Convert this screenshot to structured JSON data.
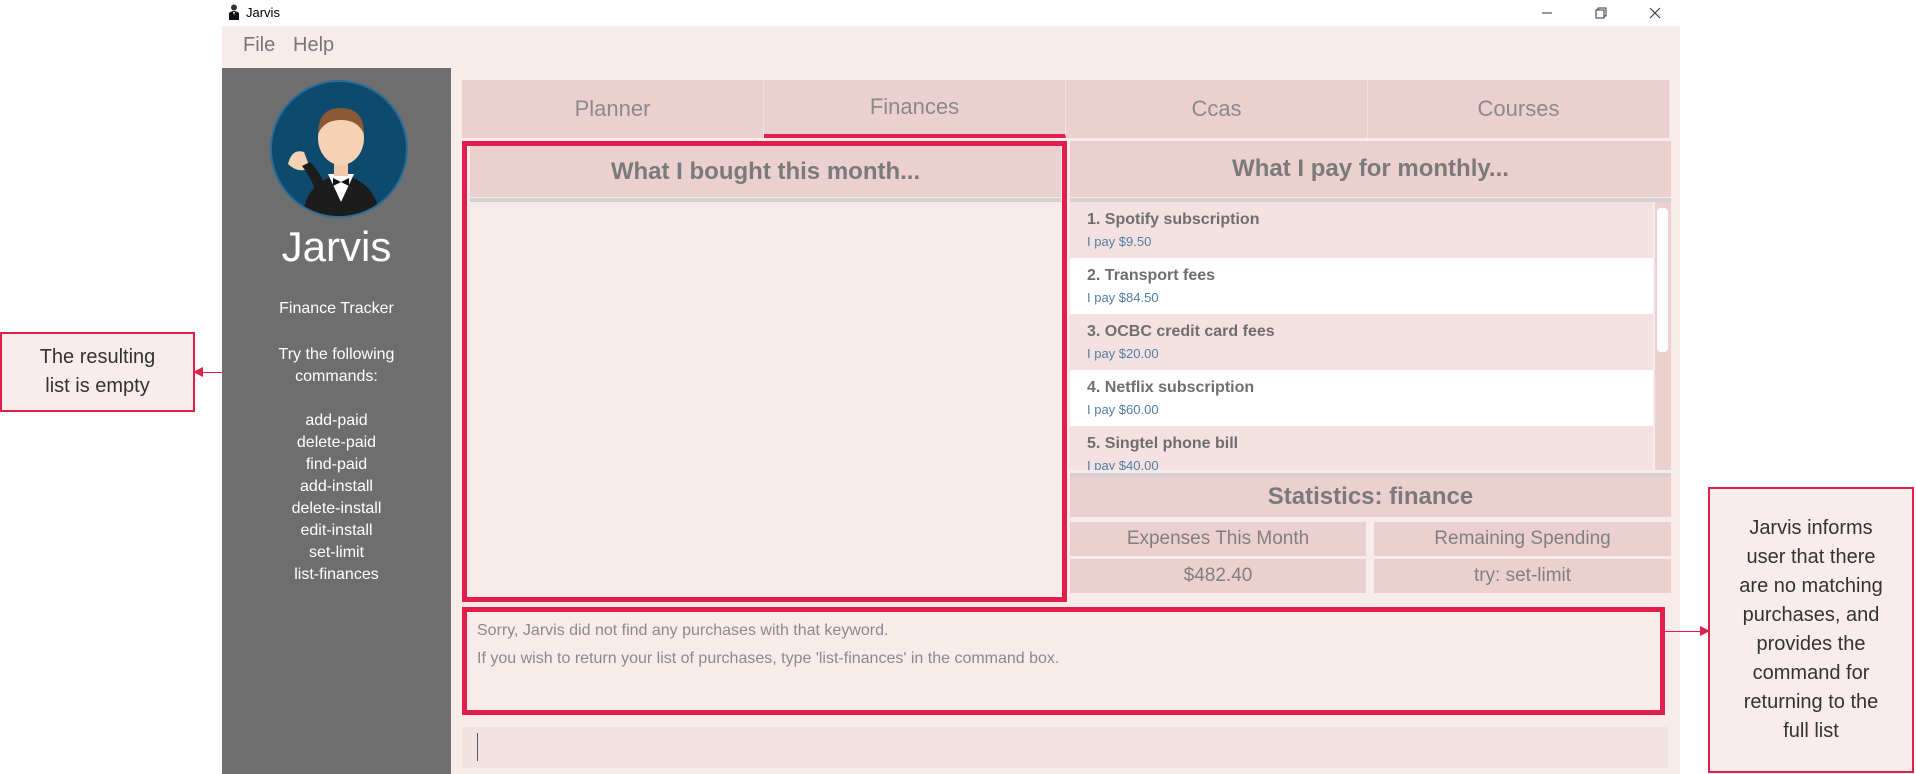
{
  "window": {
    "title": "Jarvis"
  },
  "menu": {
    "items": [
      "File",
      "Help"
    ]
  },
  "sidebar": {
    "brand": "Jarvis",
    "subtitle": "Finance Tracker",
    "try_text_1": "Try the following",
    "try_text_2": "commands:",
    "commands": [
      "add-paid",
      "delete-paid",
      "find-paid",
      "add-install",
      "delete-install",
      "edit-install",
      "set-limit",
      "list-finances"
    ]
  },
  "tabs": [
    {
      "label": "Planner",
      "active": false
    },
    {
      "label": "Finances",
      "active": true
    },
    {
      "label": "Ccas",
      "active": false
    },
    {
      "label": "Courses",
      "active": false
    }
  ],
  "purchases": {
    "header": "What I bought this month...",
    "items": []
  },
  "installments": {
    "header": "What I pay for monthly...",
    "items": [
      {
        "index": "1.",
        "name": "Spotify subscription",
        "price": "I pay $9.50"
      },
      {
        "index": "2.",
        "name": "Transport fees",
        "price": "I pay $84.50"
      },
      {
        "index": "3.",
        "name": "OCBC credit card fees",
        "price": "I pay $20.00"
      },
      {
        "index": "4.",
        "name": "Netflix subscription",
        "price": "I pay $60.00"
      },
      {
        "index": "5.",
        "name": "Singtel phone bill",
        "price": "I pay $40.00"
      }
    ]
  },
  "statistics": {
    "title": "Statistics: finance",
    "expenses_label": "Expenses This Month",
    "remaining_label": "Remaining Spending",
    "expenses_value": "$482.40",
    "remaining_value": "try: set-limit"
  },
  "result": {
    "line1": "Sorry, Jarvis did not find any purchases with that keyword.",
    "line2": "If you wish to return your list of purchases, type 'list-finances' in the command box."
  },
  "command_box": {
    "value": ""
  },
  "annotations": {
    "left_1": "The resulting",
    "left_2": "list is empty",
    "right": [
      "Jarvis informs",
      "user that there",
      "are no matching",
      "purchases, and",
      "provides the",
      "command for",
      "returning to the",
      "full list"
    ]
  },
  "colors": {
    "accent": "#e0204a",
    "sidebar": "#6e6e6e",
    "panel": "#ecd0d0",
    "background": "#f8eceb"
  }
}
